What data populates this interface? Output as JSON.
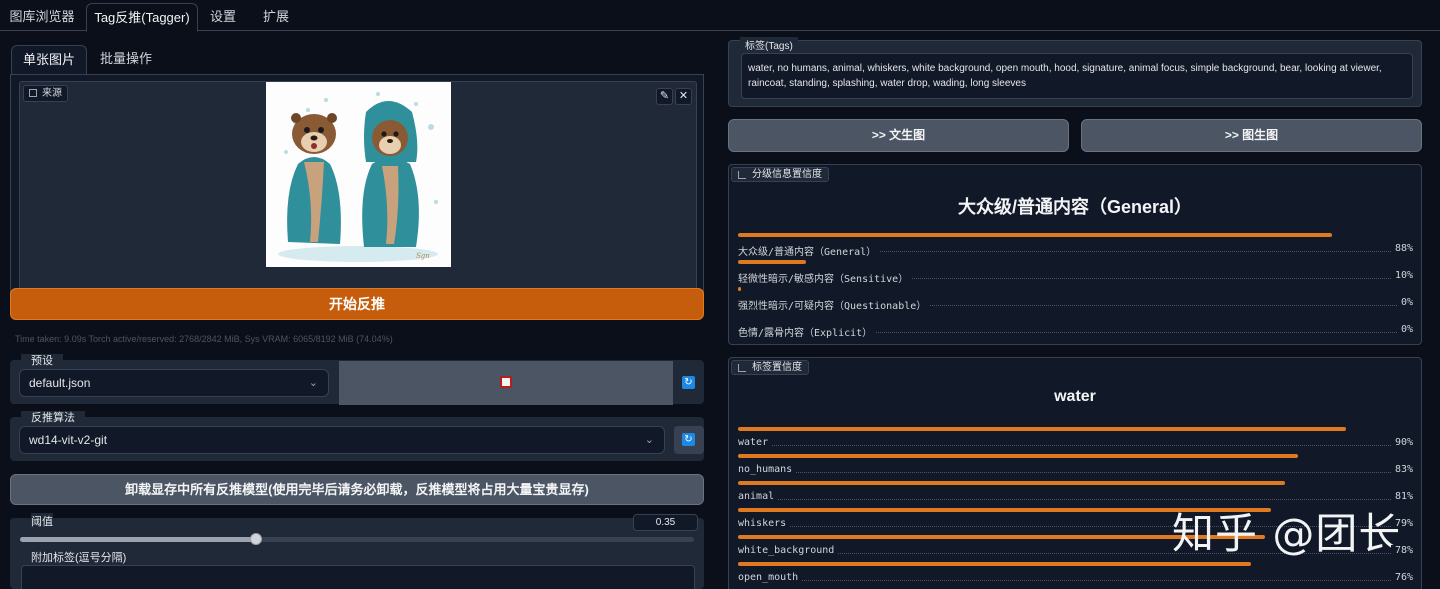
{
  "top_tabs": [
    "图库浏览器",
    "Tag反推(Tagger)",
    "设置",
    "扩展"
  ],
  "left": {
    "sub_tabs": [
      "单张图片",
      "批量操作"
    ],
    "image_label": "来源",
    "start_button": "开始反推",
    "time_info": "Time taken: 9.09s  Torch active/reserved: 2768/2842 MiB, Sys VRAM: 6065/8192 MiB (74.04%)",
    "preset_label": "预设",
    "preset_value": "default.json",
    "algo_label": "反推算法",
    "algo_value": "wd14-vit-v2-git",
    "unload_button": "卸载显存中所有反推模型(使用完毕后请务必卸载，反推模型将占用大量宝贵显存)",
    "threshold_label": "阈值",
    "threshold_value": "0.35",
    "threshold_level": 0.35,
    "extra_tags_label": "附加标签(逗号分隔)"
  },
  "right": {
    "tags_label": "标签(Tags)",
    "tags_text": "water, no humans, animal, whiskers, white background, open mouth, hood, signature, animal focus, simple background, bear, looking at viewer, raincoat, standing, splashing, water drop, wading, long sleeves",
    "btn_txt2img": ">> 文生图",
    "btn_img2img": ">> 图生图",
    "rating": {
      "label": "分级信息置信度",
      "title": "大众级/普通内容（General）",
      "rows": [
        {
          "name": "大众级/普通内容（General）",
          "pct": "88%",
          "value": 0.88
        },
        {
          "name": "轻微性暗示/敏感内容（Sensitive）",
          "pct": "10%",
          "value": 0.1
        },
        {
          "name": "强烈性暗示/可疑内容（Questionable）",
          "pct": "0%",
          "value": 0.004
        },
        {
          "name": "色情/露骨内容（Explicit）",
          "pct": "0%",
          "value": 0.0
        }
      ]
    },
    "tag_conf": {
      "label": "标签置信度",
      "title": "water",
      "rows": [
        {
          "name": "water",
          "pct": "90%",
          "value": 0.9
        },
        {
          "name": "no_humans",
          "pct": "83%",
          "value": 0.83
        },
        {
          "name": "animal",
          "pct": "81%",
          "value": 0.81
        },
        {
          "name": "whiskers",
          "pct": "79%",
          "value": 0.79
        },
        {
          "name": "white_background",
          "pct": "78%",
          "value": 0.78
        },
        {
          "name": "open_mouth",
          "pct": "76%",
          "value": 0.76
        }
      ]
    }
  },
  "watermark": "知乎 @团长",
  "colors": {
    "accent": "#e07a21",
    "primary_button": "#c65d0c",
    "background": "#0b0f19"
  }
}
